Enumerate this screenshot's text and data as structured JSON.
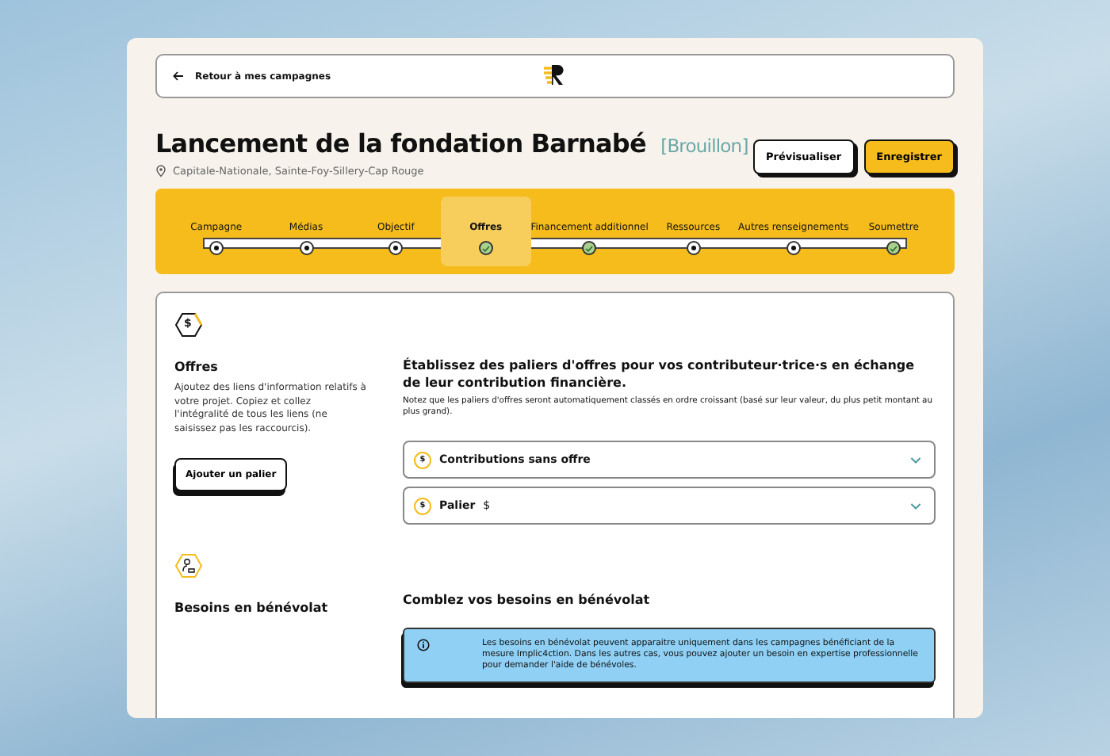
{
  "topbar": {
    "back_link": "Retour à mes campagnes"
  },
  "header": {
    "title": "Lancement de la fondation Barnabé",
    "status": "[Brouillon]",
    "location": "Capitale-Nationale, Sainte-Foy-Sillery-Cap Rouge",
    "buttons": [
      {
        "label": "Prévisualiser",
        "kind": "secondary"
      },
      {
        "label": "Enregistrer",
        "kind": "primary"
      }
    ]
  },
  "steps": [
    {
      "label": "Campagne",
      "selected": false,
      "completed": false
    },
    {
      "label": "Médias",
      "selected": false,
      "completed": false
    },
    {
      "label": "Objectif",
      "selected": false,
      "completed": false
    },
    {
      "label": "Offres",
      "selected": true,
      "completed": true
    },
    {
      "label": "Financement additionnel",
      "selected": false,
      "completed": true
    },
    {
      "label": "Ressources",
      "selected": false,
      "completed": false
    },
    {
      "label": "Autres renseignements",
      "selected": false,
      "completed": false
    },
    {
      "label": "Soumettre",
      "selected": false,
      "completed": true
    }
  ],
  "sections": [
    {
      "kind": "offers",
      "icon_text": "$",
      "title": "Offres",
      "description": "Ajoutez des liens d'information relatifs à votre projet. Copiez et collez l'intégralité de tous les liens (ne saisissez pas les raccourcis).",
      "button": "Ajouter un palier",
      "heading": "Établissez des paliers d'offres pour vos contributeur·trice·s en échange de leur contribution financière.",
      "note": "Notez que les paliers d'offres seront automatiquement classés en ordre croissant (basé sur leur valeur, du plus petit montant au plus grand).",
      "tiers": [
        {
          "icon_text": "$",
          "label": "Contributions sans offre"
        },
        {
          "icon_text": "$",
          "label": "Palier",
          "suffix": "$"
        }
      ]
    },
    {
      "kind": "volunteer",
      "title": "Besoins en bénévolat",
      "heading": "Comblez vos besoins en bénévolat",
      "info": "Les besoins en bénévolat peuvent apparaitre uniquement dans les campagnes bénéficiant de la mesure Implic4ction. Dans les autres cas, vous pouvez ajouter un besoin en expertise professionnelle pour demander l'aide de bénévoles."
    }
  ]
}
